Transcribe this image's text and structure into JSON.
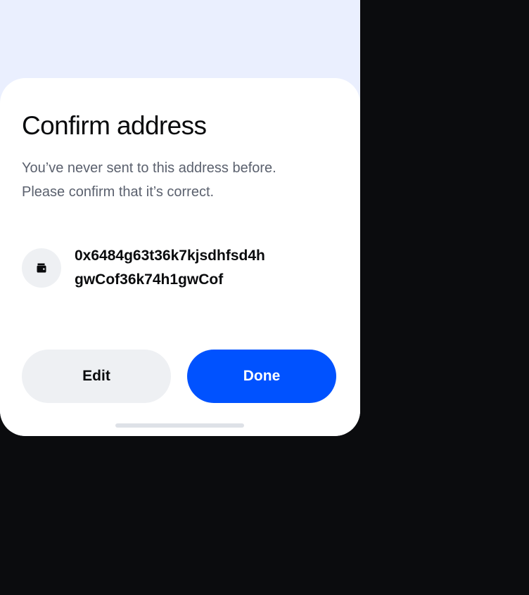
{
  "sheet": {
    "title": "Confirm address",
    "subtitle_lines": [
      "You’ve never sent to this address before.",
      "Please confirm that it’s correct."
    ],
    "address": {
      "icon": "wallet-icon",
      "lines": [
        "0x6484g63t36k7kjsdhfsd4h",
        "gwCof36k74h1gwCof"
      ]
    },
    "buttons": {
      "edit_label": "Edit",
      "done_label": "Done"
    }
  },
  "colors": {
    "primary": "#0052ff",
    "secondary_button": "#eef0f3",
    "text_primary": "#0a0b0d",
    "text_secondary": "#5b616e",
    "background_tint": "#eaeffe",
    "backdrop": "#0b0c0e"
  }
}
